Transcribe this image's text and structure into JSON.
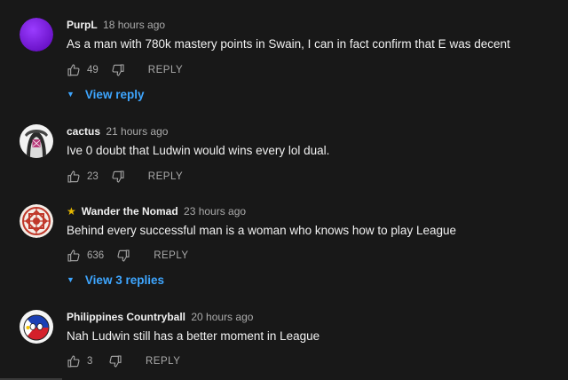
{
  "comments": [
    {
      "author": "PurpL",
      "time": "18 hours ago",
      "text": "As a man with 780k mastery points in Swain, I can in fact confirm that E was decent",
      "likes": "49",
      "reply_label": "REPLY",
      "replies_label": "View reply",
      "avatar_icon": "purple-circle-avatar",
      "avatar_color": "#7b1fd8"
    },
    {
      "author": "cactus",
      "time": "21 hours ago",
      "text": "Ive 0 doubt that Ludwin would wins every lol dual.",
      "likes": "23",
      "reply_label": "REPLY",
      "avatar_icon": "anime-character-avatar"
    },
    {
      "author": "Wander the Nomad",
      "time": "23 hours ago",
      "text": "Behind every successful man is a woman who knows how to play League",
      "likes": "636",
      "reply_label": "REPLY",
      "replies_label": "View 3 replies",
      "badge_icon": "star-icon",
      "avatar_icon": "ornament-pattern-avatar",
      "avatar_color": "#c0392b"
    },
    {
      "author": "Philippines Countryball",
      "time": "20 hours ago",
      "text": "Nah Ludwin still has a better moment in League",
      "likes": "3",
      "reply_label": "REPLY",
      "avatar_icon": "countryball-avatar"
    }
  ],
  "colors": {
    "background": "#181818",
    "link": "#3ea6ff",
    "secondary_text": "#aaaaaa"
  }
}
